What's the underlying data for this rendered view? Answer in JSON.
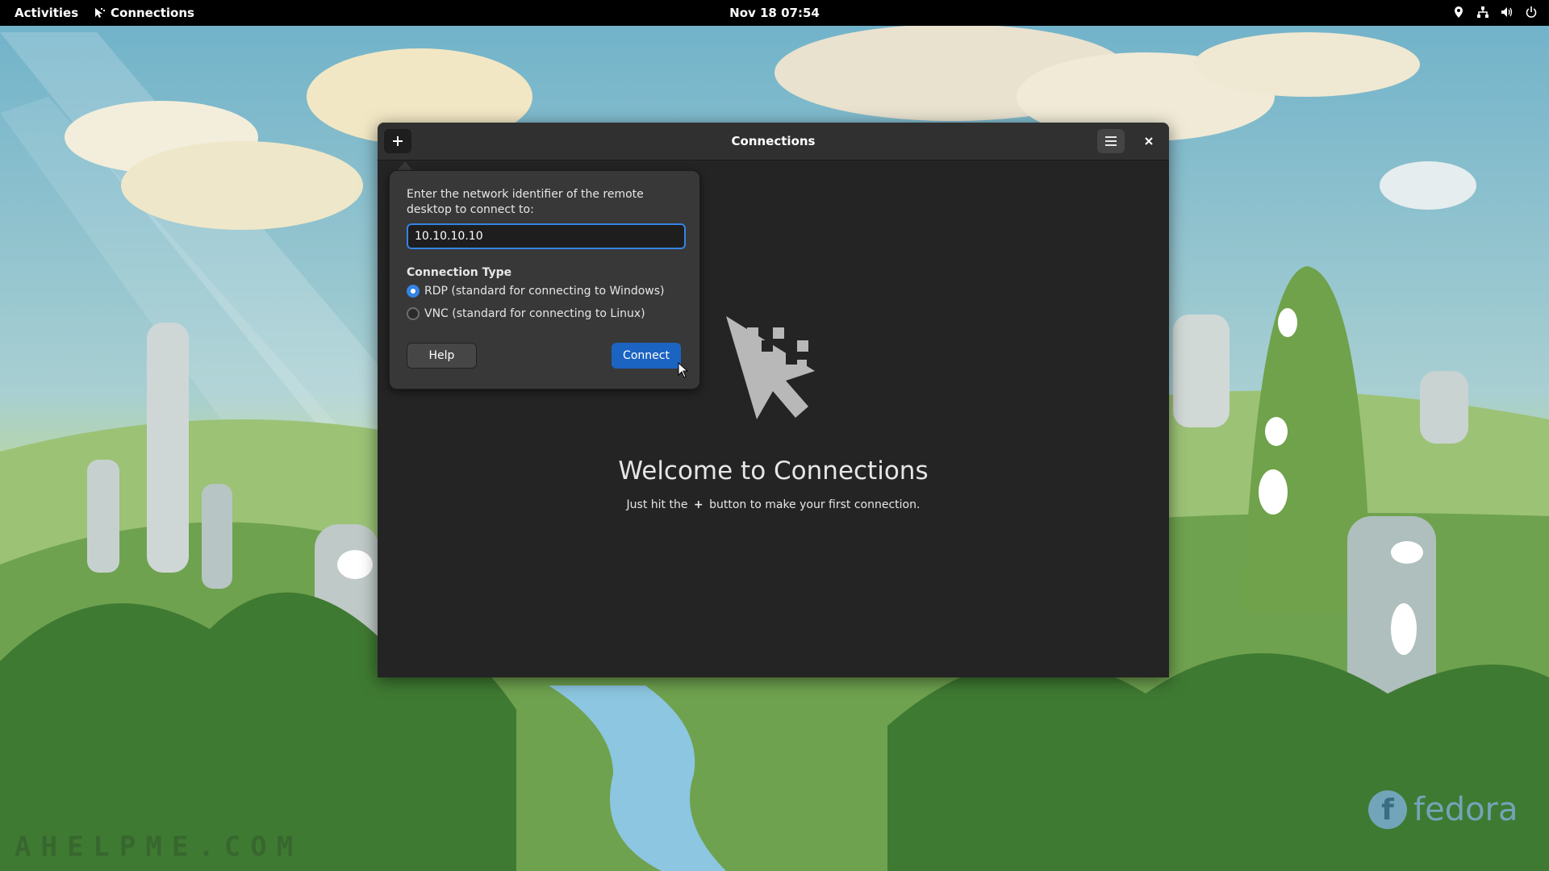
{
  "topbar": {
    "activities": "Activities",
    "app_name": "Connections",
    "clock": "Nov 18  07:54",
    "tray_icons": [
      "location-icon",
      "network-icon",
      "volume-icon",
      "power-icon"
    ]
  },
  "window": {
    "title": "Connections",
    "welcome_title": "Welcome to Connections",
    "welcome_sub_before": "Just hit the",
    "welcome_sub_plus": "+",
    "welcome_sub_after": "button to make your first connection."
  },
  "popover": {
    "prompt": "Enter the network identifier of the remote desktop to connect to:",
    "address_value": "10.10.10.10",
    "connection_type_heading": "Connection Type",
    "options": [
      {
        "label": "RDP (standard for connecting to Windows)",
        "checked": true
      },
      {
        "label": "VNC (standard for connecting to Linux)",
        "checked": false
      }
    ],
    "help_label": "Help",
    "connect_label": "Connect"
  },
  "wallpaper": {
    "watermark": "AHELPME.COM",
    "logo_text": "fedora",
    "logo_glyph": "f"
  },
  "colors": {
    "accent": "#3584e4",
    "connect_button": "#1c64c2",
    "window_bg": "#242424",
    "headerbar_bg": "#303030",
    "popover_bg": "#383838"
  }
}
